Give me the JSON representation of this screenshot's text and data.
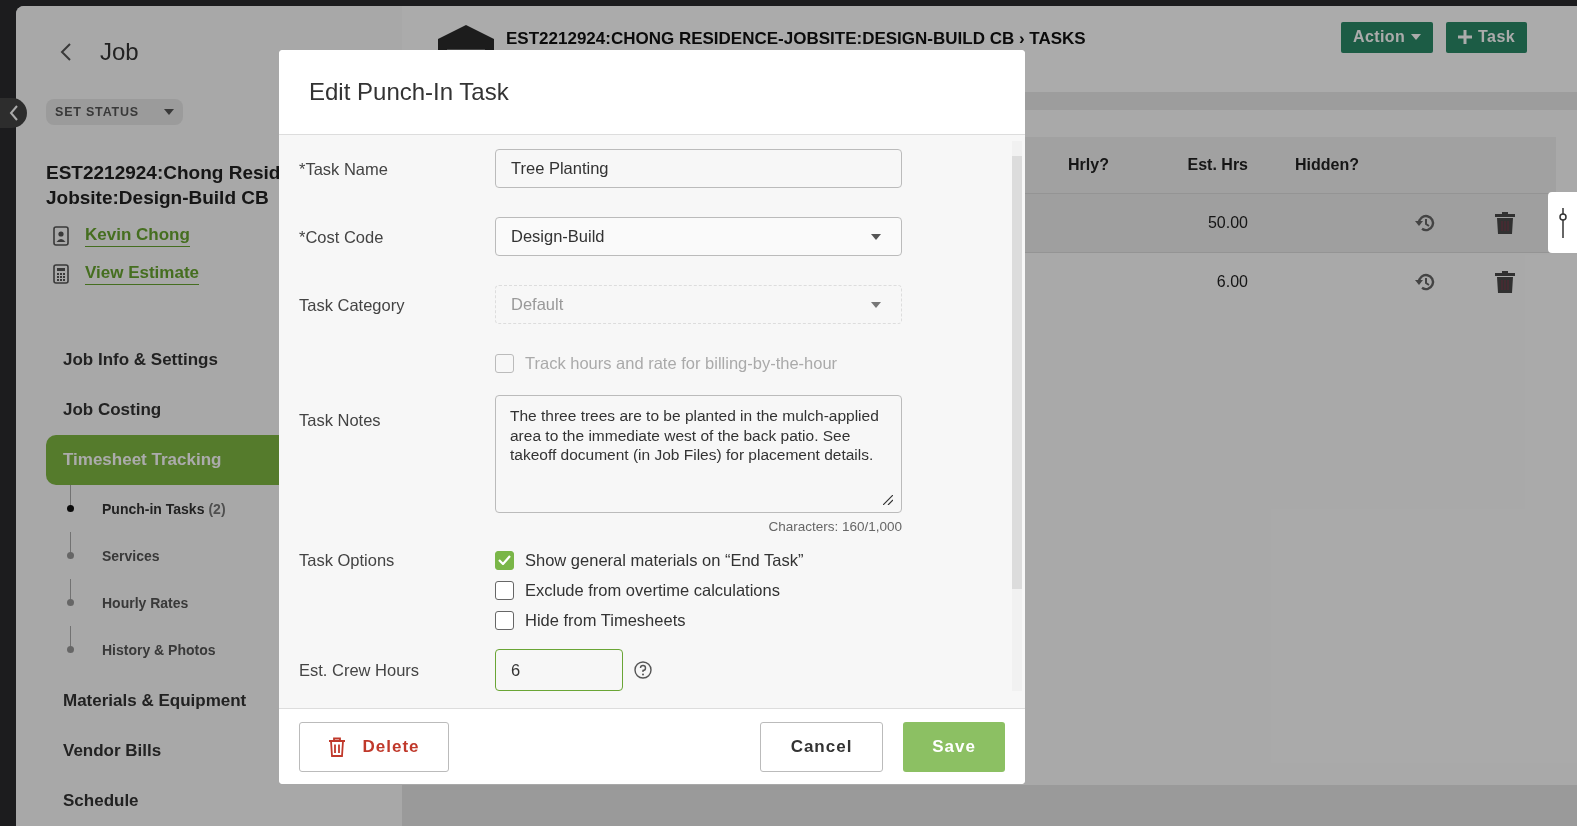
{
  "sidebar": {
    "back_label": "Job",
    "status_button": "SET STATUS",
    "job_title_lines": [
      "EST2212924:Chong Resid",
      "Jobsite:Design-Build CB"
    ],
    "links": [
      {
        "kind": "contact",
        "label": "Kevin Chong"
      },
      {
        "kind": "estimate",
        "label": "View Estimate"
      }
    ],
    "nav": [
      {
        "label": "Job Info & Settings",
        "selected": false
      },
      {
        "label": "Job Costing",
        "selected": false
      },
      {
        "label": "Timesheet Tracking",
        "selected": true,
        "children": [
          {
            "label": "Punch-in Tasks",
            "count": "(2)",
            "selected": true
          },
          {
            "label": "Services",
            "selected": false
          },
          {
            "label": "Hourly Rates",
            "selected": false
          },
          {
            "label": "History & Photos",
            "selected": false
          }
        ]
      },
      {
        "label": "Materials & Equipment",
        "selected": false
      },
      {
        "label": "Vendor Bills",
        "selected": false
      },
      {
        "label": "Schedule",
        "selected": false
      }
    ]
  },
  "header": {
    "title": "EST2212924:CHONG RESIDENCE-JOBSITE:DESIGN-BUILD CB › TASKS",
    "buttons": [
      {
        "kind": "menu",
        "label": "Action"
      },
      {
        "kind": "add",
        "label": "Task"
      }
    ]
  },
  "table": {
    "columns": [
      "Hrly?",
      "Est. Hrs",
      "Hidden?"
    ],
    "rows": [
      {
        "est_hrs": "50.00"
      },
      {
        "est_hrs": "6.00"
      }
    ]
  },
  "modal": {
    "title": "Edit Punch-In Task",
    "fields": [
      {
        "kind": "text",
        "label": "*Task Name",
        "value": "Tree Planting"
      },
      {
        "kind": "select",
        "label": "*Cost Code",
        "value": "Design-Build",
        "disabled": false
      },
      {
        "kind": "select",
        "label": "Task Category",
        "value": "Default",
        "disabled": true
      },
      {
        "kind": "checkbox",
        "label": "Track hours and rate for billing-by-the-hour",
        "checked": false,
        "disabled": true
      },
      {
        "kind": "notes",
        "label": "Task Notes",
        "value": "The three trees are to be planted in the mulch-applied area to the immediate west of the back patio. See takeoff document (in Job Files) for placement details.",
        "counter": "Characters: 160/1,000"
      },
      {
        "kind": "options",
        "label": "Task Options",
        "options": [
          {
            "label": "Show general materials on “End Task”",
            "checked": true
          },
          {
            "label": "Exclude from overtime calculations",
            "checked": false
          },
          {
            "label": "Hide from Timesheets",
            "checked": false
          }
        ]
      },
      {
        "kind": "number",
        "label": "Est. Crew Hours",
        "value": "6"
      }
    ],
    "buttons": [
      {
        "kind": "delete",
        "label": "Delete"
      },
      {
        "kind": "cancel",
        "label": "Cancel"
      },
      {
        "kind": "save",
        "label": "Save"
      }
    ]
  }
}
